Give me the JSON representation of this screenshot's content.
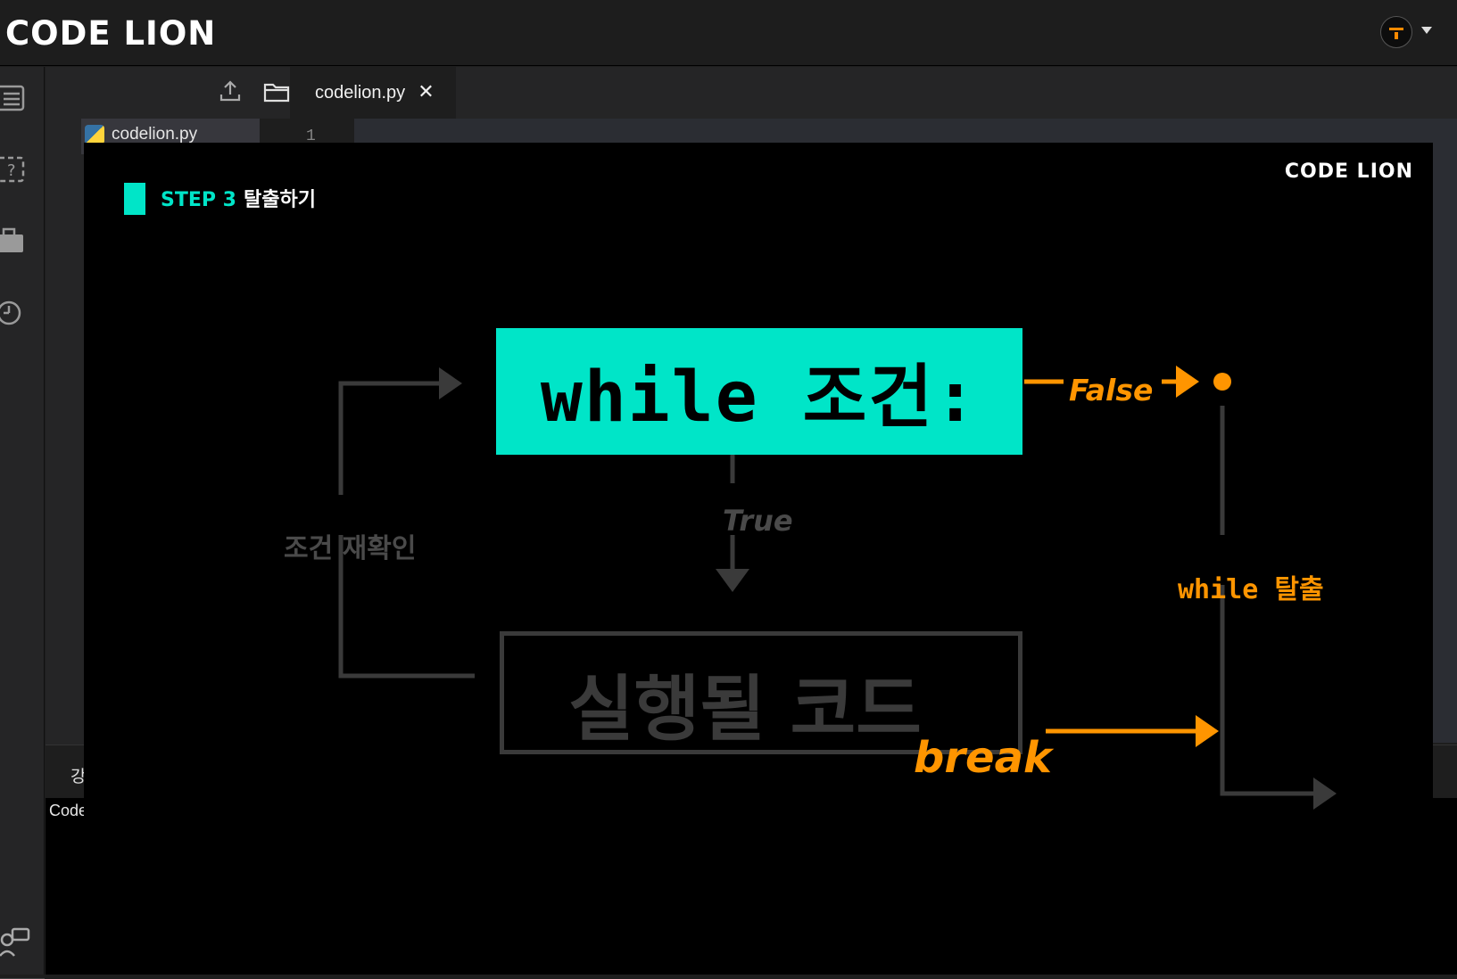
{
  "brand": {
    "name": "CODE LION"
  },
  "explorer": {
    "file": "codelion.py"
  },
  "editor": {
    "tab": "codelion.py",
    "tab_close": "✕",
    "line_number": "1"
  },
  "panel": {
    "tab_label": "강",
    "console_text": "Code"
  },
  "video": {
    "step_label": "STEP 3",
    "step_title": "탈출하기",
    "logo": "CODE LION",
    "while_text": "while 조건:",
    "code_text": "실행될 코드",
    "false_label": "False",
    "true_label": "True",
    "recheck_label": "조건 재확인",
    "escape_label": "while 탈출",
    "break_label": "break"
  },
  "colors": {
    "accent_teal": "#00e5c8",
    "accent_orange": "#ff9500",
    "brand_orange": "#ff8a00"
  },
  "icons": [
    "list-icon",
    "help-icon",
    "briefcase-icon",
    "history-icon",
    "chat-icon",
    "upload-icon",
    "folder-icon",
    "python-file-icon",
    "avatar-icon",
    "chevron-down-icon",
    "close-icon"
  ]
}
